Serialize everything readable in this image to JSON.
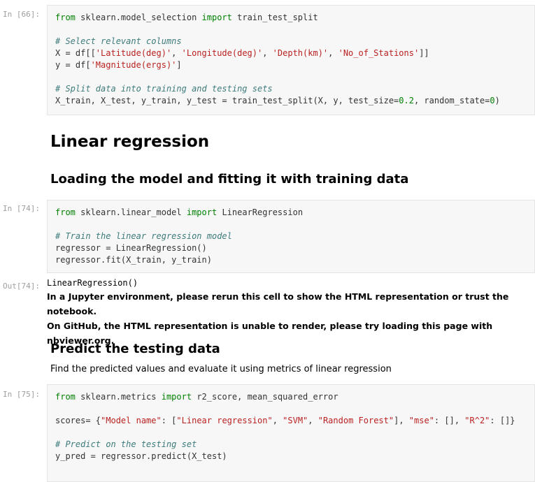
{
  "cells": {
    "split": {
      "prompt": "In [66]:",
      "lines": [
        "from sklearn.model_selection import train_test_split",
        "",
        "# Select relevant columns",
        "X = df[['Latitude(deg)', 'Longitude(deg)', 'Depth(km)', 'No_of_Stations']]",
        "y = df['Magnitude(ergs)']",
        "",
        "# Split data into training and testing sets",
        "X_train, X_test, y_train, y_test = train_test_split(X, y, test_size=0.2, random_state=0)"
      ]
    },
    "fit": {
      "prompt": "In [74]:",
      "lines": [
        "from sklearn.linear_model import LinearRegression",
        "",
        "# Train the linear regression model",
        "regressor = LinearRegression()",
        "regressor.fit(X_train, y_train)"
      ],
      "output_prompt": "Out[74]:",
      "output_repr": "LinearRegression()",
      "output_warning_1": "In a Jupyter environment, please rerun this cell to show the HTML representation or trust the notebook.",
      "output_warning_2": "On GitHub, the HTML representation is unable to render, please try loading this page with nbviewer.org."
    },
    "predict": {
      "prompt": "In [75]:",
      "lines": [
        "from sklearn.metrics import r2_score, mean_squared_error",
        "",
        "scores= {\"Model name\": [\"Linear regression\", \"SVM\", \"Random Forest\"], \"mse\": [], \"R^2\": []}",
        "",
        "# Predict on the testing set",
        "y_pred = regressor.predict(X_test)"
      ]
    }
  },
  "markdown": {
    "h1_linear_regression": "Linear regression",
    "h2_loading": "Loading the model and fitting it with training data",
    "h2_predict": "Predict the testing data",
    "p_predict": "Find the predicted values and evaluate it using metrics of linear regression"
  }
}
